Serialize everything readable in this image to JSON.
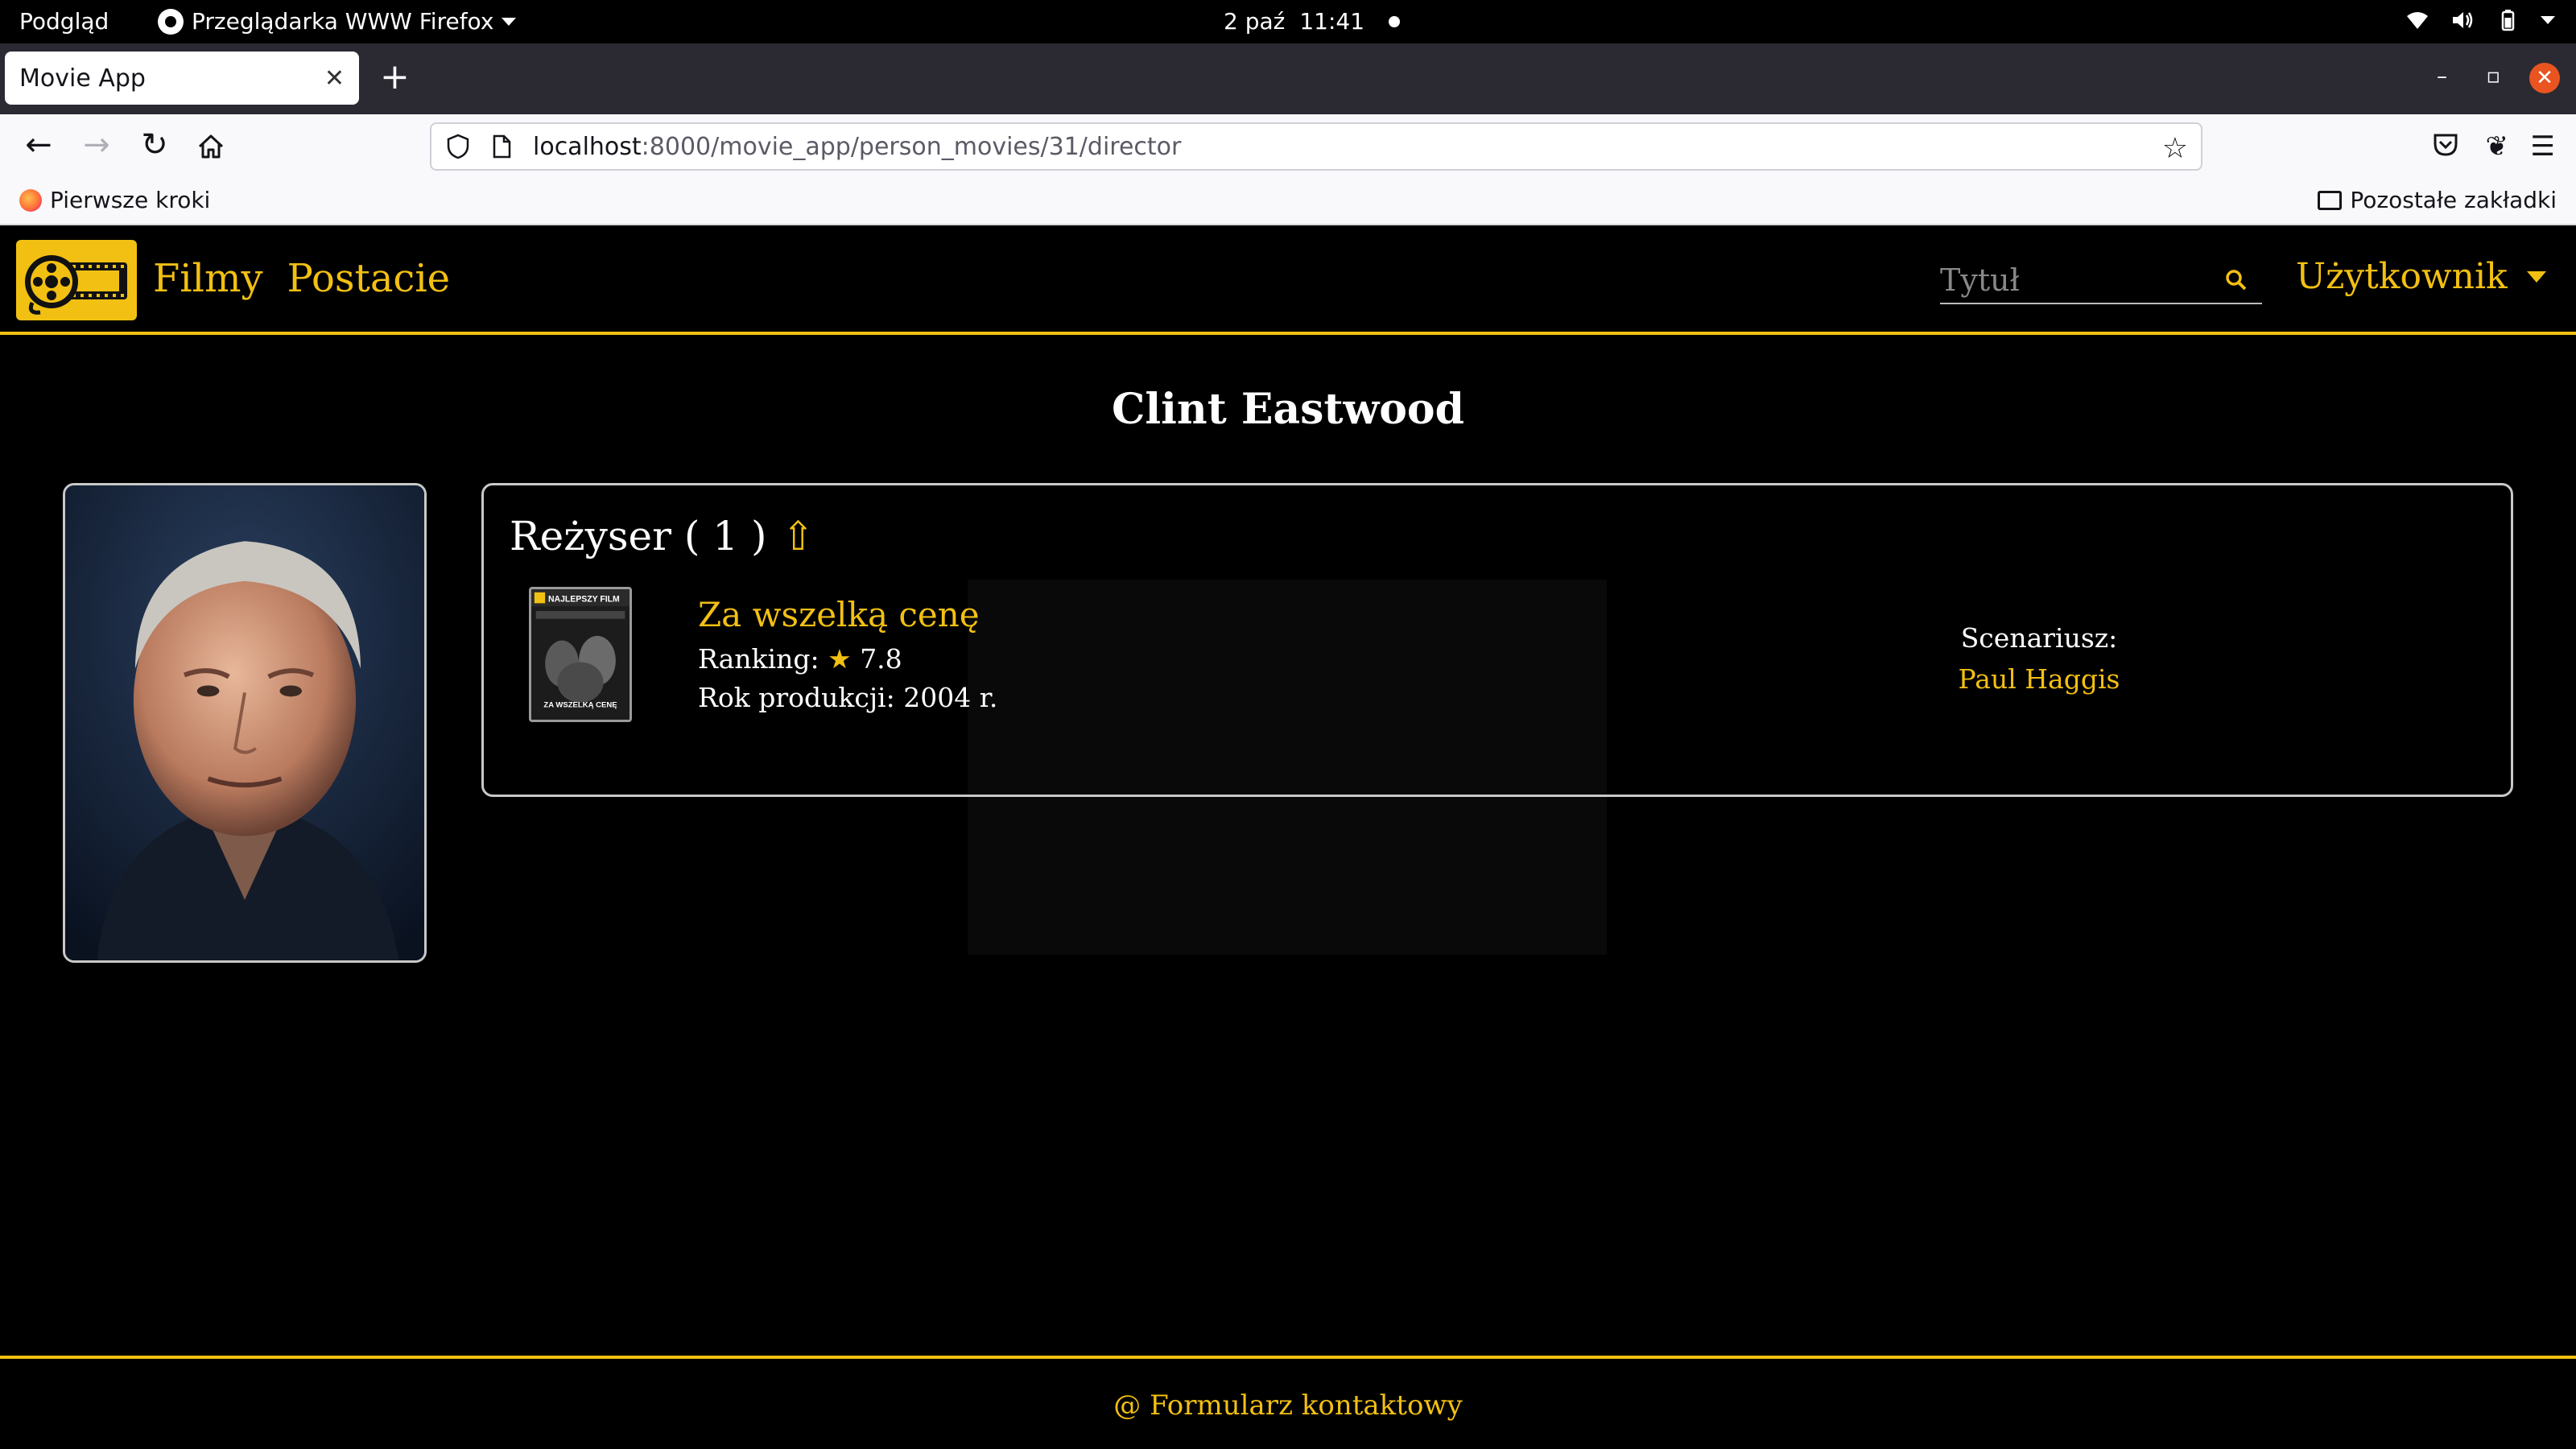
{
  "system_bar": {
    "activities": "Podgląd",
    "app_name": "Przeglądarka WWW Firefox",
    "date": "2 paź",
    "time": "11:41"
  },
  "browser": {
    "tab_title": "Movie App",
    "url_host": "localhost",
    "url_rest": ":8000/movie_app/person_movies/31/director",
    "bookmark_first": "Pierwsze kroki",
    "bookmark_other": "Pozostałe zakładki"
  },
  "site": {
    "nav": [
      "Filmy",
      "Postacie"
    ],
    "search_placeholder": "Tytuł",
    "user_menu": "Użytkownik",
    "accent_color": "#f2c012"
  },
  "person": {
    "name": "Clint Eastwood"
  },
  "role_section": {
    "title": "Reżyser ( 1 )",
    "collapse_glyph": "⇧",
    "movies": [
      {
        "title": "Za wszelką cenę",
        "ranking_label": "Ranking:",
        "ranking_star": "★",
        "ranking_value": "7.8",
        "year_text": "Rok produkcji: 2004 r.",
        "poster_badge": "NAJLEPSZY FILM",
        "poster_title": "ZA WSZELKĄ CENĘ",
        "writer_label": "Scenariusz:",
        "writer_name": "Paul Haggis"
      }
    ]
  },
  "footer": {
    "contact_link": "@ Formularz kontaktowy"
  }
}
